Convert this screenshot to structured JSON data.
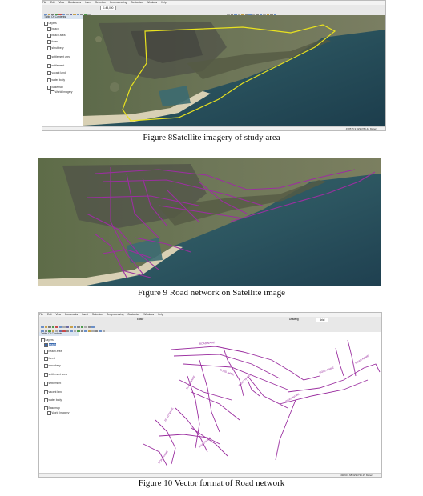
{
  "figure8": {
    "caption": "Figure 8Satellite imagery of study area",
    "menu": [
      "File",
      "Edit",
      "View",
      "Bookmarks",
      "Insert",
      "Selection",
      "Geoprocessing",
      "Customize",
      "Windows",
      "Help"
    ],
    "scale": "1:45,000",
    "toc_title": "Table Of Contents",
    "layers": [
      "Layers",
      "beach",
      "beach area",
      "forest",
      "shrubbery",
      "settlement area",
      "settlement",
      "vacant land",
      "water body",
      "Basemap",
      "World Imagery"
    ],
    "status": "498575.9 3295785.42 Meters"
  },
  "figure9": {
    "caption": "Figure 9 Road network on Satellite image"
  },
  "figure10": {
    "caption": "Figure 10 Vector format of Road network",
    "menu": [
      "File",
      "Edit",
      "View",
      "Bookmarks",
      "Insert",
      "Selection",
      "Geoprocessing",
      "Customize",
      "Windows",
      "Help"
    ],
    "editor_label": "Editor",
    "drawing_label": "Drawing",
    "font_label": "Arial",
    "toc_title": "Table Of Contents",
    "layers": [
      "Layers",
      "beach",
      "beach area",
      "forest",
      "shrubbery",
      "settlement area",
      "settlement",
      "vacant land",
      "water body",
      "Basemap",
      "World Imagery"
    ],
    "road_labels": [
      "ROAD NAME",
      "ROAD NAME",
      "ROAD NAME",
      "ROAD NAME",
      "ROAD NAME",
      "ROAD NAME",
      "ROAD NAME",
      "ROAD NAME",
      "ROAD NAME",
      "ROAD NAME"
    ],
    "status": "498601.68 3295735.25 Meters"
  },
  "colors": {
    "road": "#9b2fa0",
    "boundary": "#e9e21f",
    "sea": "#2b5560",
    "land": "#6f7a5a",
    "sand": "#d8d0b4"
  }
}
